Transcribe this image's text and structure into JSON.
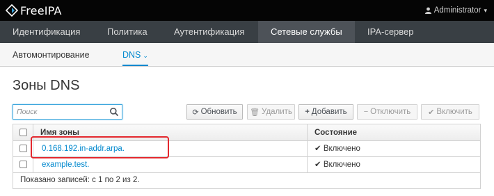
{
  "header": {
    "brand": "FreeIPA",
    "user": "Administrator"
  },
  "primary_nav": [
    {
      "label": "Идентификация",
      "active": false
    },
    {
      "label": "Политика",
      "active": false
    },
    {
      "label": "Аутентификация",
      "active": false
    },
    {
      "label": "Сетевые службы",
      "active": true
    },
    {
      "label": "IPA-сервер",
      "active": false
    }
  ],
  "secondary_nav": [
    {
      "label": "Автомонтирование",
      "active": false
    },
    {
      "label": "DNS",
      "active": true
    }
  ],
  "page": {
    "title": "Зоны DNS"
  },
  "search": {
    "placeholder": "Поиск",
    "value": ""
  },
  "toolbar": {
    "refresh": "Обновить",
    "delete": "Удалить",
    "add": "Добавить",
    "disable": "Отключить",
    "enable": "Включить"
  },
  "table": {
    "columns": [
      "Имя зоны",
      "Состояние"
    ],
    "rows": [
      {
        "zone": "0.168.192.in-addr.arpa.",
        "status": "Включено"
      },
      {
        "zone": "example.test.",
        "status": "Включено"
      }
    ],
    "footer": "Показано записей: с 1 по 2 из 2."
  },
  "colors": {
    "topbar": "#050505",
    "nav": "#393f44",
    "nav_active": "#4d5258",
    "accent": "#0088ce",
    "highlight": "#e3282e"
  }
}
